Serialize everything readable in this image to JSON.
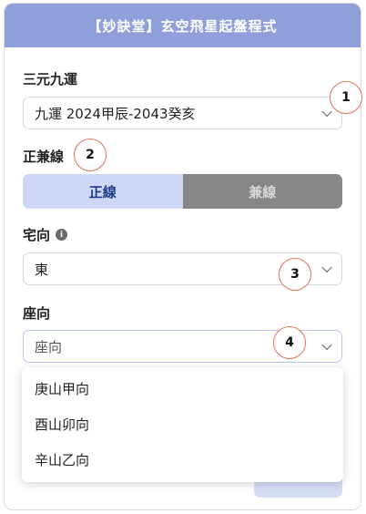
{
  "header": {
    "title": "【妙訣堂】玄空飛星起盤程式"
  },
  "yun": {
    "label": "三元九運",
    "value": "九運 2024甲辰-2043癸亥"
  },
  "line": {
    "label": "正兼線",
    "options": [
      "正線",
      "兼線"
    ],
    "active": "正線"
  },
  "zhai": {
    "label": "宅向",
    "value": "東",
    "info_icon": "info-icon"
  },
  "zuo": {
    "label": "座向",
    "placeholder": "座向",
    "options": [
      "庚山甲向",
      "酉山卯向",
      "辛山乙向"
    ]
  },
  "markers": [
    "1",
    "2",
    "3",
    "4"
  ],
  "colors": {
    "header": "#8f9fd9",
    "marker_border": "#e0735a",
    "active_tab": "#ccd8f6",
    "inactive_tab": "#868688"
  }
}
